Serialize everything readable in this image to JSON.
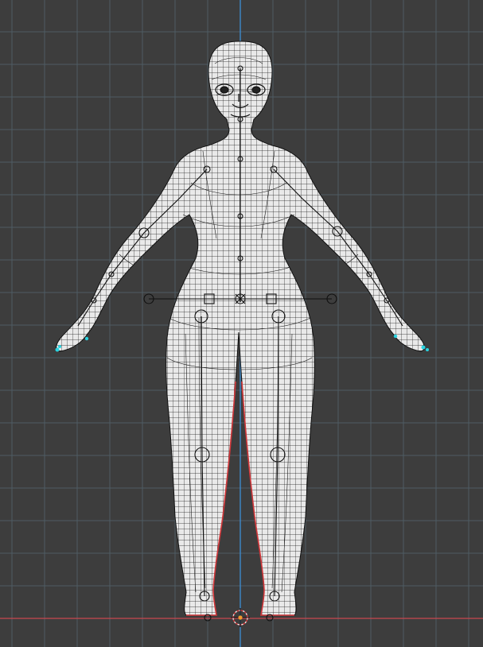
{
  "viewport": {
    "view": "front-orthographic",
    "display_mode": "wireframe",
    "background_color": "#3d3d3d",
    "grid_color": "#4f5b63",
    "z_axis_color": "#3d8fd6",
    "x_axis_color": "#c8474f",
    "mesh_fill_color": "#e9e9e9",
    "wire_color": "#1a1a1a",
    "selected_color": "#29d3e0",
    "boundary_color": "#d2373a",
    "origin_color": "#f39a2e",
    "show_grid": true,
    "show_armature": true
  },
  "objects": [
    {
      "name": "character-mesh",
      "type": "mesh",
      "pose": "A-pose"
    },
    {
      "name": "armature",
      "type": "armature"
    },
    {
      "name": "3d-cursor",
      "type": "cursor",
      "icon": "crosshair-icon"
    }
  ]
}
